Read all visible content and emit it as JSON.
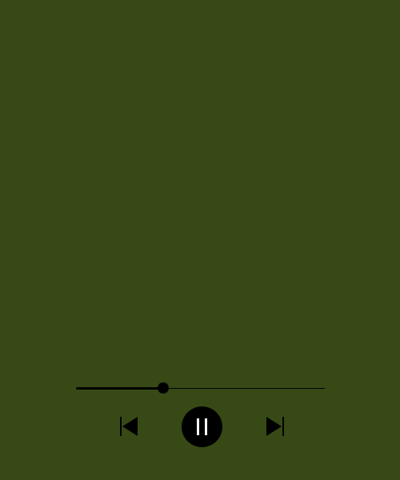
{
  "theme": {
    "background": "#374a16",
    "foreground": "#000000",
    "icon_on_dark": "#ffffff"
  },
  "playback": {
    "progress_fraction": 0.35,
    "state": "playing"
  },
  "controls": {
    "previous_icon": "skip-previous-icon",
    "pause_icon": "pause-icon",
    "next_icon": "skip-next-icon"
  }
}
